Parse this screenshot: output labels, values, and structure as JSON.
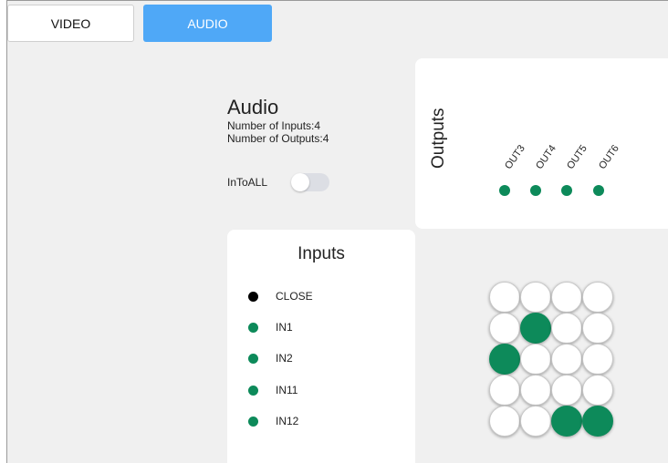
{
  "tabs": [
    {
      "label": "VIDEO",
      "active": false
    },
    {
      "label": "AUDIO",
      "active": true
    }
  ],
  "info": {
    "title": "Audio",
    "inputs_count": "Number of Inputs:4",
    "outputs_count": "Number of Outputs:4"
  },
  "toggle": {
    "label": "InToALL",
    "on": false
  },
  "outputs": {
    "title": "Outputs",
    "items": [
      "OUT3",
      "OUT4",
      "OUT5",
      "OUT6"
    ]
  },
  "inputs": {
    "title": "Inputs",
    "items": [
      {
        "label": "CLOSE",
        "color": "#000000"
      },
      {
        "label": "IN1",
        "color": "#0d8a5a"
      },
      {
        "label": "IN2",
        "color": "#0d8a5a"
      },
      {
        "label": "IN11",
        "color": "#0d8a5a"
      },
      {
        "label": "IN12",
        "color": "#0d8a5a"
      }
    ]
  },
  "matrix_state": [
    [
      0,
      0,
      0,
      0
    ],
    [
      0,
      1,
      0,
      0
    ],
    [
      1,
      0,
      0,
      0
    ],
    [
      0,
      0,
      0,
      0
    ],
    [
      0,
      0,
      1,
      1
    ]
  ],
  "colors": {
    "accent": "#4fa8f7",
    "active_green": "#0d8a5a",
    "background": "#f0f0f0"
  }
}
